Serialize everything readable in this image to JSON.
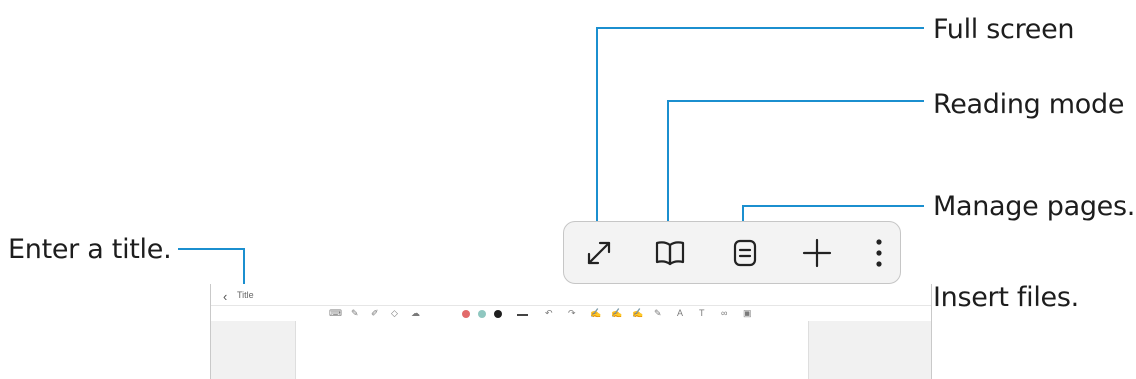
{
  "callouts": {
    "full_screen": "Full screen",
    "reading_mode": "Reading mode",
    "manage_pages": "Manage pages.",
    "enter_title": "Enter a title.",
    "insert_files": "Insert files."
  },
  "toolbar": {
    "buttons": [
      {
        "icon": "expand-diagonal-icon"
      },
      {
        "icon": "open-book-icon"
      },
      {
        "icon": "page-list-icon"
      },
      {
        "icon": "plus-icon"
      },
      {
        "icon": "more-vertical-icon"
      }
    ]
  },
  "note": {
    "back_glyph": "‹",
    "title": "Title",
    "pen_colors": [
      "#e26a6a",
      "#8fc7c0",
      "#1f1f1f"
    ]
  },
  "colors": {
    "callout_line": "#1b8fcf",
    "toolbar_bg": "#f3f3f3",
    "toolbar_border": "#c6c6c6",
    "icon": "#222222"
  }
}
